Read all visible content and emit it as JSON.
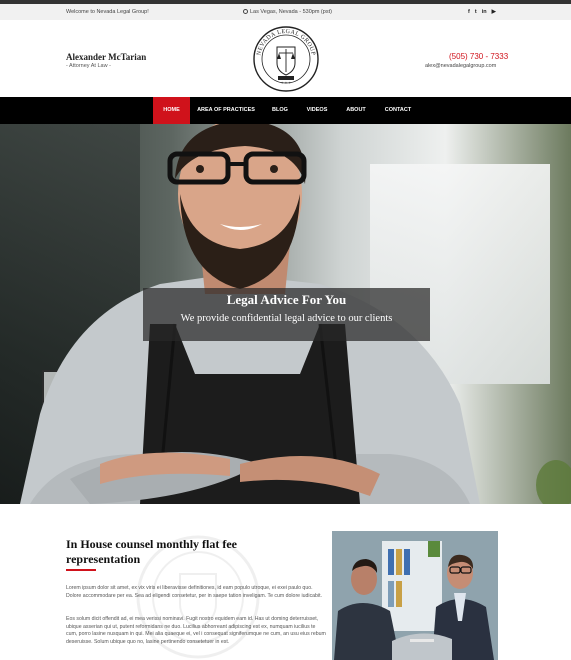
{
  "topbar": {
    "welcome": "Welcome to Nevada Legal Group!",
    "location": "Las Vegas, Nevada - 530pm (pst)",
    "social": [
      {
        "icon": "facebook-icon",
        "glyph": "f"
      },
      {
        "icon": "twitter-icon",
        "glyph": "t"
      },
      {
        "icon": "linkedin-icon",
        "glyph": "in"
      },
      {
        "icon": "youtube-icon",
        "glyph": "▶"
      }
    ]
  },
  "header": {
    "name": "Alexander McTarian",
    "title": "- Attorney At Law -",
    "logo_text": "NEVADA LEGAL GROUP",
    "phone": "(505) 730 - 7333",
    "email": "alex@nevadalegalgroup.com"
  },
  "nav": {
    "items": [
      {
        "label": "HOME",
        "active": true
      },
      {
        "label": "AREA OF PRACTICES",
        "active": false
      },
      {
        "label": "BLOG",
        "active": false
      },
      {
        "label": "VIDEOS",
        "active": false
      },
      {
        "label": "ABOUT",
        "active": false
      },
      {
        "label": "CONTACT",
        "active": false
      }
    ]
  },
  "hero": {
    "heading": "Legal Advice For You",
    "subheading": "We provide confidential legal advice to our clients"
  },
  "content": {
    "heading": "In House counsel monthly flat fee representation",
    "paragraph1": "Lorem ipsum dolor sit amet, ex vix viris ei liberavisse definitiones, id eam populo utroque, ei exei paulo quo. Dolore accommodare per ea. Sea ad eligendi consetetur, per in saepe tation inveligam. Te cum dolore iudicabit.",
    "paragraph2": "Eos solum dicit offendit ad, ei mea verissi nominavi. Fugit nostro equidem eam id. Has ut doming deterruisset, ubique asserian qui ut, putent reformidans ne duo. Lucilius abhorreant adipiscing est ex, numquam iucilius te cum, porro lasine nusquam in qui. Mei alia quaeque ei, vel i consequat signiferumque ne cum, an usu eius rebum deseruisse. Solum ubique quo no, lasine pertinendo consetetuer in est."
  },
  "colors": {
    "accent": "#d0121b",
    "nav_bg": "#000000",
    "topbar_bg": "#f1f1f1"
  }
}
